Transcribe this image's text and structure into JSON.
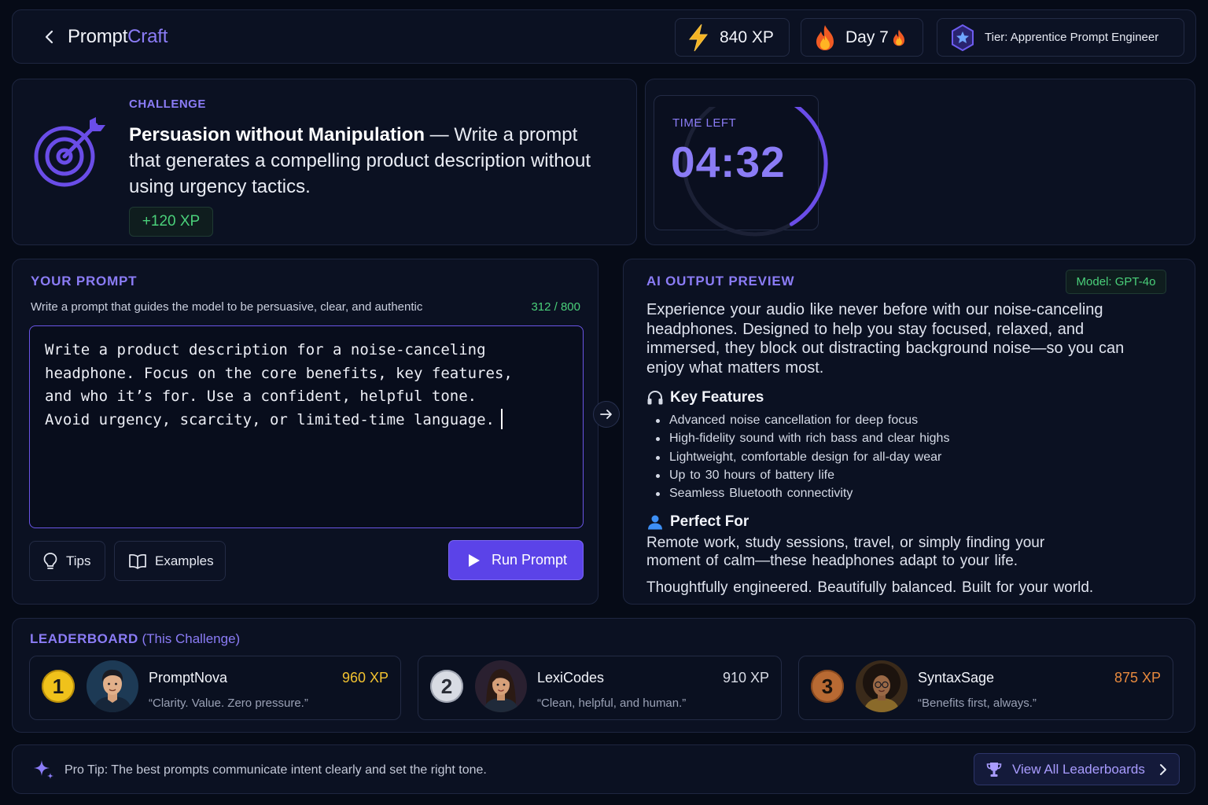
{
  "header": {
    "brand_part1": "Prompt",
    "brand_part2": "Craft",
    "xp": "840 XP",
    "streak": "Day 7",
    "tier": "Tier: Apprentice Prompt Engineer"
  },
  "challenge": {
    "tag": "CHALLENGE",
    "title": "Persuasion without Manipulation",
    "description": " — Write a prompt that generates a compelling product description without using urgency tactics.",
    "reward": "+120 XP"
  },
  "timer": {
    "label": "TIME LEFT",
    "value": "04:32",
    "ring_fraction_remaining": 0.4
  },
  "prompt": {
    "title": "YOUR PROMPT",
    "hint": "Write a prompt that guides the model to be persuasive, clear, and authentic",
    "char_count": "312 / 800",
    "text": "Write a product description for a noise-canceling\nheadphone. Focus on the core benefits, key features,\nand who it’s for. Use a confident, helpful tone.\nAvoid urgency, scarcity, or limited-time language.",
    "tips_label": "Tips",
    "examples_label": "Examples",
    "run_label": "Run Prompt"
  },
  "output": {
    "title": "AI OUTPUT PREVIEW",
    "model": "Model: GPT-4o",
    "intro": "Experience your audio like never before with our noise-canceling headphones. Designed to help you stay focused, relaxed, and immersed, they block out distracting background noise—so you can enjoy what matters most.",
    "features_heading": "Key Features",
    "features": [
      "Advanced noise cancellation for deep focus",
      "High-fidelity sound with rich bass and clear highs",
      "Lightweight, comfortable design for all-day wear",
      "Up to 30 hours of battery life",
      "Seamless Bluetooth connectivity"
    ],
    "perfect_heading": "Perfect For",
    "perfect_text": "Remote work, study sessions, travel, or simply finding your moment of calm—these headphones adapt to your life.",
    "closing": "Thoughtfully engineered. Beautifully balanced. Built for your world."
  },
  "leaderboard": {
    "title": "LEADERBOARD",
    "subtitle": "(This Challenge)",
    "entries": [
      {
        "rank": "1",
        "name": "PromptNova",
        "quote": "“Clarity. Value. Zero pressure.”",
        "xp": "960 XP",
        "xp_color": "#f2c230"
      },
      {
        "rank": "2",
        "name": "LexiCodes",
        "quote": "“Clean, helpful, and human.”",
        "xp": "910 XP",
        "xp_color": "#d9dce6"
      },
      {
        "rank": "3",
        "name": "SyntaxSage",
        "quote": "“Benefits first, always.”",
        "xp": "875 XP",
        "xp_color": "#e88a3e"
      }
    ]
  },
  "footer": {
    "tip": "Pro Tip: The best prompts communicate intent clearly and set the right tone.",
    "view_all": "View All Leaderboards"
  },
  "colors": {
    "accent": "#8b7cf6",
    "run_button": "#5b43e8",
    "success": "#4ad07a",
    "background": "#060b17"
  }
}
